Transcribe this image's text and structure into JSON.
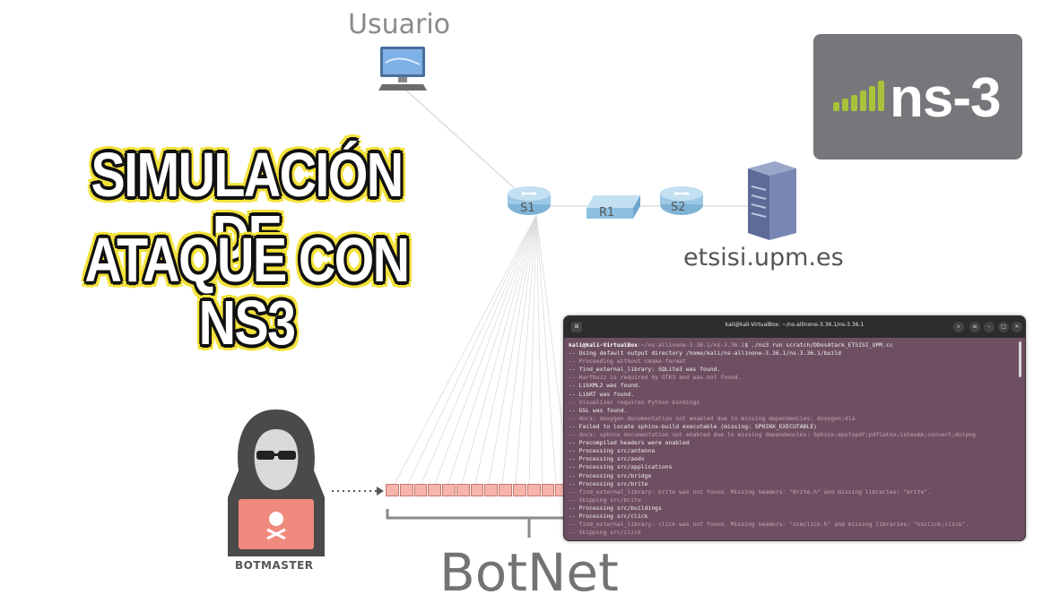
{
  "title": {
    "line1": "SIMULACIÓN DE",
    "line2": "ATAQUE CON NS3"
  },
  "logo": {
    "text": "ns-3"
  },
  "network": {
    "user_label": "Usuario",
    "server_label": "etsisi.upm.es",
    "router_s1": "S1",
    "router_r1": "R1",
    "router_s2": "S2",
    "botmaster_label": "BOTMASTER",
    "botnet_label": "BotNet"
  },
  "terminal": {
    "title": "kali@kali-VirtualBox: ~/ns-allinone-3.36.1/ns-3.36.1",
    "prompt_user": "kali@kali-VirtualBox",
    "prompt_path": ":~/ns-allinone-3.36.1/ns-3.36.1",
    "command": "$ ./ns3 run scratch/DDosAtack_ETSISI_UPM.cc",
    "lines": [
      {
        "text": "-- Using default output directory /home/kali/ns-allinone-3.36.1/ns-3.36.1/build",
        "dim": false
      },
      {
        "text": "-- Proceeding without cmake-format",
        "dim": true
      },
      {
        "text": "-- find_external_library: SQLite3 was found.",
        "dim": false
      },
      {
        "text": "-- Harfbuzz is required by GTK3 and was not found.",
        "dim": true
      },
      {
        "text": "-- LibXML2 was found.",
        "dim": false
      },
      {
        "text": "-- LibRT was found.",
        "dim": false
      },
      {
        "text": "-- Visualizer requires Python bindings",
        "dim": true
      },
      {
        "text": "-- GSL was found.",
        "dim": false
      },
      {
        "text": "-- docs: doxygen documentation not enabled due to missing dependencies: doxygen;dia",
        "dim": true
      },
      {
        "text": "-- Failed to locate sphinx-build executable (missing: SPHINX_EXECUTABLE)",
        "dim": false
      },
      {
        "text": "-- docs: sphinx documentation not enabled due to missing dependencies: Sphinx;epstopdf;pdflatex;latexmk;convert;dvipng",
        "dim": true
      },
      {
        "text": "-- Precompiled headers were enabled",
        "dim": false
      },
      {
        "text": "-- Processing src/antenna",
        "dim": false
      },
      {
        "text": "-- Processing src/aodv",
        "dim": false
      },
      {
        "text": "-- Processing src/applications",
        "dim": false
      },
      {
        "text": "-- Processing src/bridge",
        "dim": false
      },
      {
        "text": "-- Processing src/brite",
        "dim": false
      },
      {
        "text": "-- find_external_library: brite was not found. Missing headers: \"Brite.h\" and missing libraries: \"brite\".",
        "dim": true
      },
      {
        "text": "-- Skipping src/brite",
        "dim": true
      },
      {
        "text": "-- Processing src/buildings",
        "dim": false
      },
      {
        "text": "-- Processing src/click",
        "dim": false
      },
      {
        "text": "-- find_external_library: click was not found. Missing headers: \"simclick.h\" and missing libraries: \"nsclick;click\".",
        "dim": true
      },
      {
        "text": "-- Skipping src/click",
        "dim": true
      }
    ]
  },
  "colors": {
    "title_outline": "#f3e23a",
    "logo_bg": "#77777b",
    "logo_bars": "#a8c23a",
    "terminal_bg": "#6e4f62"
  }
}
